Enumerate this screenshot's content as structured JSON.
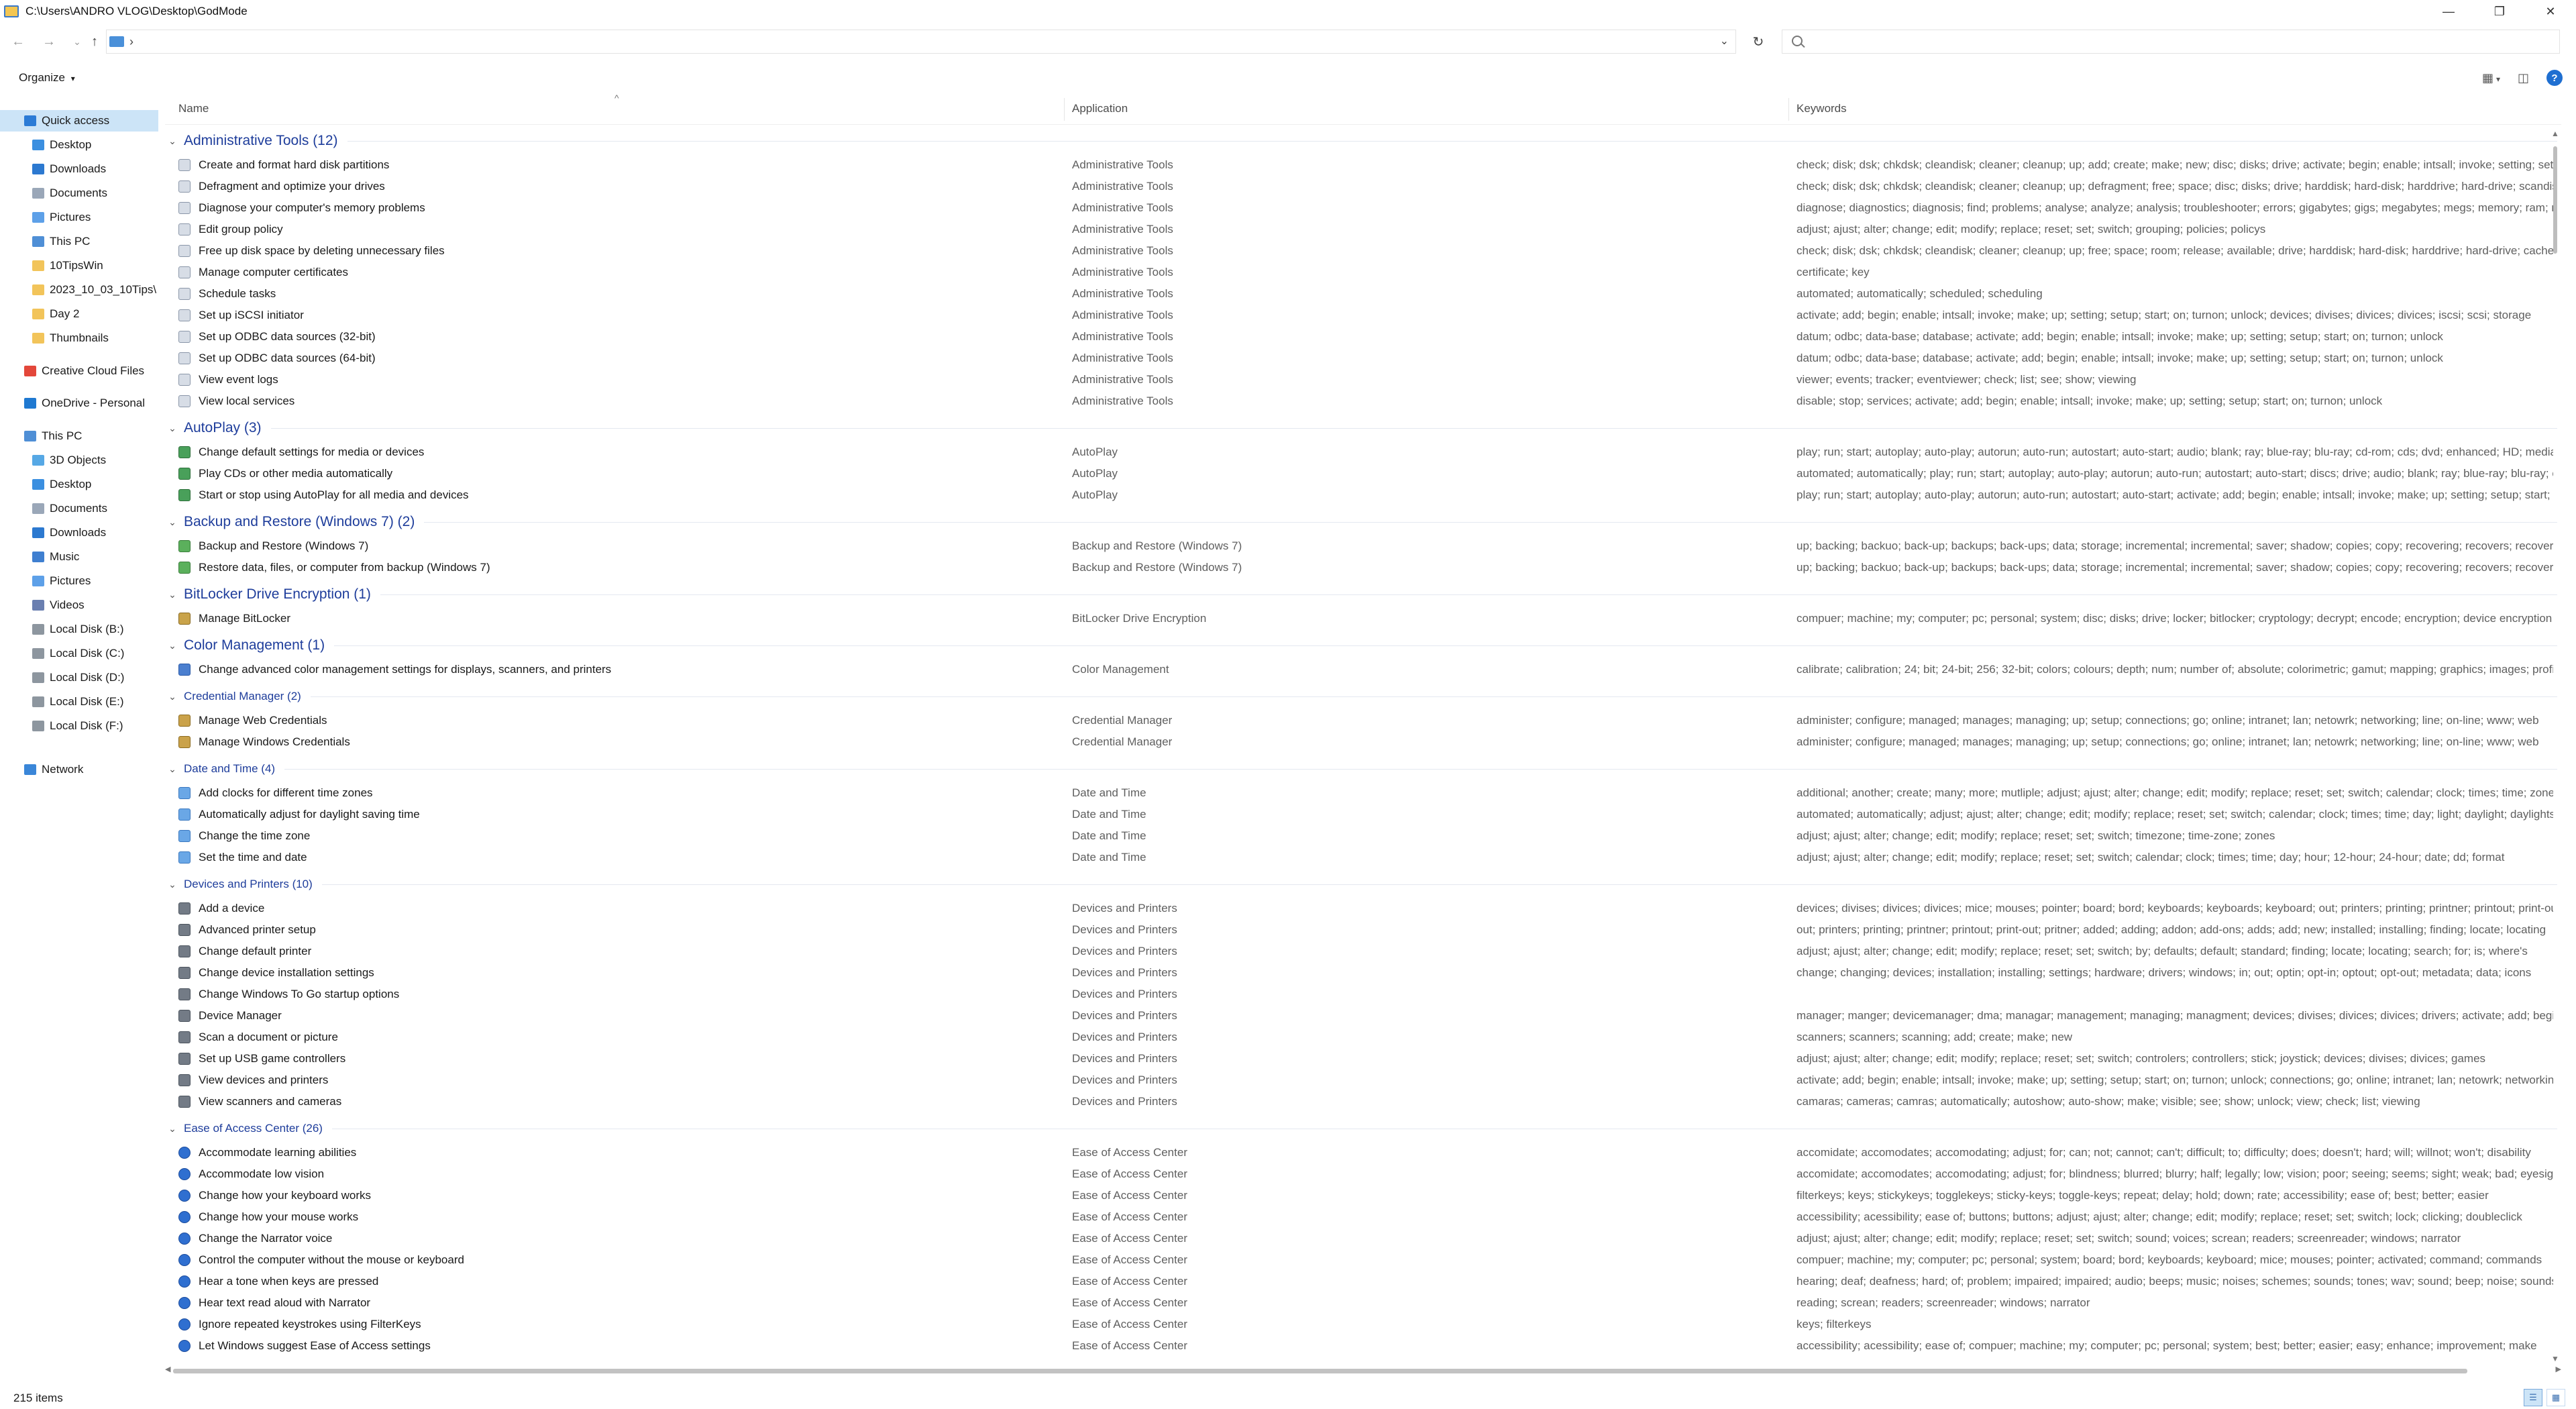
{
  "window": {
    "title": "C:\\Users\\ANDRO VLOG\\Desktop\\GodMode",
    "minimize": "—",
    "maximize": "❐",
    "close": "✕"
  },
  "address": {
    "chevron": "›",
    "dropdown": "⌄",
    "refresh": "↻",
    "search_placeholder": ""
  },
  "nav": {
    "back": "←",
    "forward": "→",
    "recent": "⌄",
    "up": "↑"
  },
  "toolbar": {
    "organize": "Organize",
    "organize_arrow": "▾",
    "view_icon": "▦",
    "view_arrow": "▾",
    "pane_icon": "◫",
    "help": "?"
  },
  "sidebar": {
    "items": [
      {
        "label": "Quick access",
        "indent": 1,
        "icon": "star-icon",
        "color": "#2b7bd6",
        "selected": true,
        "pinned": false
      },
      {
        "label": "Desktop",
        "indent": 2,
        "icon": "desktop-icon",
        "color": "#3b8fe0",
        "selected": false,
        "pinned": true
      },
      {
        "label": "Downloads",
        "indent": 2,
        "icon": "download-icon",
        "color": "#2c79d0",
        "selected": false,
        "pinned": true
      },
      {
        "label": "Documents",
        "indent": 2,
        "icon": "documents-icon",
        "color": "#9aa7b8",
        "selected": false,
        "pinned": true
      },
      {
        "label": "Pictures",
        "indent": 2,
        "icon": "pictures-icon",
        "color": "#5da0e8",
        "selected": false,
        "pinned": true
      },
      {
        "label": "This PC",
        "indent": 2,
        "icon": "computer-icon",
        "color": "#4f8fd6",
        "selected": false,
        "pinned": true
      },
      {
        "label": "10TipsWin",
        "indent": 2,
        "icon": "folder-icon",
        "color": "#f2c45a",
        "selected": false,
        "pinned": false
      },
      {
        "label": "2023_10_03_10Tips\\",
        "indent": 2,
        "icon": "folder-icon",
        "color": "#f2c45a",
        "selected": false,
        "pinned": false
      },
      {
        "label": "Day 2",
        "indent": 2,
        "icon": "folder-icon",
        "color": "#f2c45a",
        "selected": false,
        "pinned": false
      },
      {
        "label": "Thumbnails",
        "indent": 2,
        "icon": "folder-icon",
        "color": "#f2c45a",
        "selected": false,
        "pinned": false
      },
      {
        "label": "Creative Cloud Files",
        "indent": 1,
        "icon": "creative-cloud-icon",
        "color": "#e3473a",
        "selected": false,
        "pinned": false
      },
      {
        "label": "OneDrive - Personal",
        "indent": 1,
        "icon": "cloud-icon",
        "color": "#1f79d1",
        "selected": false,
        "pinned": false
      },
      {
        "label": "This PC",
        "indent": 1,
        "icon": "computer-icon",
        "color": "#4f8fd6",
        "selected": false,
        "pinned": false
      },
      {
        "label": "3D Objects",
        "indent": 2,
        "icon": "cube-icon",
        "color": "#56a8e5",
        "selected": false,
        "pinned": false
      },
      {
        "label": "Desktop",
        "indent": 2,
        "icon": "desktop-icon",
        "color": "#3b8fe0",
        "selected": false,
        "pinned": false
      },
      {
        "label": "Documents",
        "indent": 2,
        "icon": "documents-icon",
        "color": "#9aa7b8",
        "selected": false,
        "pinned": false
      },
      {
        "label": "Downloads",
        "indent": 2,
        "icon": "download-icon",
        "color": "#2c79d0",
        "selected": false,
        "pinned": false
      },
      {
        "label": "Music",
        "indent": 2,
        "icon": "music-icon",
        "color": "#3f7fd0",
        "selected": false,
        "pinned": false
      },
      {
        "label": "Pictures",
        "indent": 2,
        "icon": "pictures-icon",
        "color": "#5da0e8",
        "selected": false,
        "pinned": false
      },
      {
        "label": "Videos",
        "indent": 2,
        "icon": "video-icon",
        "color": "#6a7fb0",
        "selected": false,
        "pinned": false
      },
      {
        "label": "Local Disk (B:)",
        "indent": 2,
        "icon": "drive-icon",
        "color": "#8d969f",
        "selected": false,
        "pinned": false
      },
      {
        "label": "Local Disk (C:)",
        "indent": 2,
        "icon": "drive-icon",
        "color": "#8d969f",
        "selected": false,
        "pinned": false
      },
      {
        "label": "Local Disk (D:)",
        "indent": 2,
        "icon": "drive-icon",
        "color": "#8d969f",
        "selected": false,
        "pinned": false
      },
      {
        "label": "Local Disk (E:)",
        "indent": 2,
        "icon": "drive-icon",
        "color": "#8d969f",
        "selected": false,
        "pinned": false
      },
      {
        "label": "Local Disk (F:)",
        "indent": 2,
        "icon": "drive-icon",
        "color": "#8d969f",
        "selected": false,
        "pinned": false
      },
      {
        "label": "Network",
        "indent": 1,
        "icon": "network-icon",
        "color": "#3a86d8",
        "selected": false,
        "pinned": false
      }
    ],
    "pin_glyph": "📌"
  },
  "columns": {
    "name": "Name",
    "application": "Application",
    "keywords": "Keywords",
    "sort_glyph": "^"
  },
  "groups": [
    {
      "header": "Administrative Tools (12)",
      "large": true,
      "icon": "ic-admin",
      "items": [
        {
          "name": "Create and format hard disk partitions",
          "app": "Administrative Tools",
          "kw": "check; disk; dsk; chkdsk; cleandisk; cleaner; cleanup; up; add; create; make; new; disc; disks; drive; activate; begin; enable; intsall; invoke; setting; setup; start; on; turnon; unlock; dis"
        },
        {
          "name": "Defragment and optimize your drives",
          "app": "Administrative Tools",
          "kw": "check; disk; dsk; chkdsk; cleandisk; cleaner; cleanup; up; defragment; free; space; disc; disks; drive; harddisk; hard-disk; harddrive; hard-drive; scandisk; scan-disk; defrag"
        },
        {
          "name": "Diagnose your computer's memory problems",
          "app": "Administrative Tools",
          "kw": "diagnose; diagnostics; diagnosis; find; problems; analyse; analyze; analysis; troubleshooter; errors; gigabytes; gigs; megabytes; megs; memory; ram; random; access; chips; diag"
        },
        {
          "name": "Edit group policy",
          "app": "Administrative Tools",
          "kw": "adjust; ajust; alter; change; edit; modify; replace; reset; set; switch; grouping; policies; policys"
        },
        {
          "name": "Free up disk space by deleting unnecessary files",
          "app": "Administrative Tools",
          "kw": "check; disk; dsk; chkdsk; cleandisk; cleaner; cleanup; up; free; space; room; release; available; drive; harddisk; hard-disk; harddrive; hard-drive; cache; files; temporary"
        },
        {
          "name": "Manage computer certificates",
          "app": "Administrative Tools",
          "kw": "certificate; key"
        },
        {
          "name": "Schedule tasks",
          "app": "Administrative Tools",
          "kw": "automated; automatically; scheduled; scheduling"
        },
        {
          "name": "Set up iSCSI initiator",
          "app": "Administrative Tools",
          "kw": "activate; add; begin; enable; intsall; invoke; make; up; setting; setup; start; on; turnon; unlock; devices; divises; divices; divices; iscsi; scsi; storage"
        },
        {
          "name": "Set up ODBC data sources (32-bit)",
          "app": "Administrative Tools",
          "kw": "datum; odbc; data-base; database; activate; add; begin; enable; intsall; invoke; make; up; setting; setup; start; on; turnon; unlock"
        },
        {
          "name": "Set up ODBC data sources (64-bit)",
          "app": "Administrative Tools",
          "kw": "datum; odbc; data-base; database; activate; add; begin; enable; intsall; invoke; make; up; setting; setup; start; on; turnon; unlock"
        },
        {
          "name": "View event logs",
          "app": "Administrative Tools",
          "kw": "viewer; events; tracker; eventviewer; check; list; see; show; viewing"
        },
        {
          "name": "View local services",
          "app": "Administrative Tools",
          "kw": "disable; stop; services; activate; add; begin; enable; intsall; invoke; make; up; setting; setup; start; on; turnon; unlock"
        }
      ]
    },
    {
      "header": "AutoPlay (3)",
      "large": true,
      "icon": "ic-auto",
      "items": [
        {
          "name": "Change default settings for media or devices",
          "app": "AutoPlay",
          "kw": "play; run; start; autoplay; auto-play; autorun; auto-run; autostart; auto-start; audio; blank; ray; blue-ray; blu-ray; cd-rom; cds; dvd; enhanced; HD; media; movies; music"
        },
        {
          "name": "Play CDs or other media automatically",
          "app": "AutoPlay",
          "kw": "automated; automatically; play; run; start; autoplay; auto-play; autorun; auto-run; autostart; auto-start; discs; drive; audio; blank; ray; blue-ray; blu-ray; cd"
        },
        {
          "name": "Start or stop using AutoPlay for all media and devices",
          "app": "AutoPlay",
          "kw": "play; run; start; autoplay; auto-play; autorun; auto-run; autostart; auto-start; activate; add; begin; enable; intsall; invoke; make; up; setting; setup; start; on"
        }
      ]
    },
    {
      "header": "Backup and Restore (Windows 7) (2)",
      "large": true,
      "icon": "ic-backup",
      "items": [
        {
          "name": "Backup and Restore (Windows 7)",
          "app": "Backup and Restore (Windows 7)",
          "kw": "up; backing; backuo; back-up; backups; back-ups; data; storage; incremental; incremental; saver; shadow; copies; copy; recovering; recovers; recovery; restore"
        },
        {
          "name": "Restore data, files, or computer from backup (Windows 7)",
          "app": "Backup and Restore (Windows 7)",
          "kw": "up; backing; backuo; back-up; backups; back-ups; data; storage; incremental; incremental; saver; shadow; copies; copy; recovering; recovers; recovery; restore"
        }
      ]
    },
    {
      "header": "BitLocker Drive Encryption (1)",
      "large": true,
      "icon": "ic-bitlocker",
      "items": [
        {
          "name": "Manage BitLocker",
          "app": "BitLocker Drive Encryption",
          "kw": "compuer; machine; my; computer; pc; personal; system; disc; disks; drive; locker; bitlocker; cryptology; decrypt; encode; encryption; device encryption"
        }
      ]
    },
    {
      "header": "Color Management (1)",
      "large": true,
      "icon": "ic-color",
      "items": [
        {
          "name": "Change advanced color management settings for displays, scanners, and printers",
          "app": "Color Management",
          "kw": "calibrate; calibration; 24; bit; 24-bit; 256; 32-bit; colors; colours; depth; num; number of; absolute; colorimetric; gamut; mapping; graphics; images; profile"
        }
      ]
    },
    {
      "header": "Credential Manager (2)",
      "large": false,
      "icon": "ic-cred",
      "items": [
        {
          "name": "Manage Web Credentials",
          "app": "Credential Manager",
          "kw": "administer; configure; managed; manages; managing; up; setup; connections; go; online; intranet; lan; netowrk; networking; line; on-line; www; web"
        },
        {
          "name": "Manage Windows Credentials",
          "app": "Credential Manager",
          "kw": "administer; configure; managed; manages; managing; up; setup; connections; go; online; intranet; lan; netowrk; networking; line; on-line; www; web"
        }
      ]
    },
    {
      "header": "Date and Time (4)",
      "large": false,
      "icon": "ic-date",
      "items": [
        {
          "name": "Add clocks for different time zones",
          "app": "Date and Time",
          "kw": "additional; another; create; many; more; mutliple; adjust; ajust; alter; change; edit; modify; replace; reset; set; switch; calendar; clock; times; time; zones"
        },
        {
          "name": "Automatically adjust for daylight saving time",
          "app": "Date and Time",
          "kw": "automated; automatically; adjust; ajust; alter; change; edit; modify; replace; reset; set; switch; calendar; clock; times; time; day; light; daylight; daylightsavings"
        },
        {
          "name": "Change the time zone",
          "app": "Date and Time",
          "kw": "adjust; ajust; alter; change; edit; modify; replace; reset; set; switch; timezone; time-zone; zones"
        },
        {
          "name": "Set the time and date",
          "app": "Date and Time",
          "kw": "adjust; ajust; alter; change; edit; modify; replace; reset; set; switch; calendar; clock; times; time; day; hour; 12-hour; 24-hour; date; dd; format"
        }
      ]
    },
    {
      "header": "Devices and Printers (10)",
      "large": false,
      "icon": "ic-dev",
      "items": [
        {
          "name": "Add a device",
          "app": "Devices and Printers",
          "kw": "devices; divises; divices; divices; mice; mouses; pointer; board; bord; keyboards; keyboards; keyboard; out; printers; printing; printner; printout; print-out"
        },
        {
          "name": "Advanced printer setup",
          "app": "Devices and Printers",
          "kw": "out; printers; printing; printner; printout; print-out; pritner; added; adding; addon; add-ons; adds; add; new; installed; installing; finding; locate; locating"
        },
        {
          "name": "Change default printer",
          "app": "Devices and Printers",
          "kw": "adjust; ajust; alter; change; edit; modify; replace; reset; set; switch; by; defaults; default; standard; finding; locate; locating; search; for; is; where's"
        },
        {
          "name": "Change device installation settings",
          "app": "Devices and Printers",
          "kw": "change; changing; devices; installation; installing; settings; hardware; drivers; windows; in; out; optin; opt-in; optout; opt-out; metadata; data; icons"
        },
        {
          "name": "Change Windows To Go startup options",
          "app": "Devices and Printers",
          "kw": ""
        },
        {
          "name": "Device Manager",
          "app": "Devices and Printers",
          "kw": "manager; manger; devicemanager; dma; managar; management; managing; managment; devices; divises; divices; divices; drivers; activate; add; begin"
        },
        {
          "name": "Scan a document or picture",
          "app": "Devices and Printers",
          "kw": "scanners; scanners; scanning; add; create; make; new"
        },
        {
          "name": "Set up USB game controllers",
          "app": "Devices and Printers",
          "kw": "adjust; ajust; alter; change; edit; modify; replace; reset; set; switch; controlers; controllers; stick; joystick; devices; divises; divices; games"
        },
        {
          "name": "View devices and printers",
          "app": "Devices and Printers",
          "kw": "activate; add; begin; enable; intsall; invoke; make; up; setting; setup; start; on; turnon; unlock; connections; go; online; intranet; lan; netowrk; networking"
        },
        {
          "name": "View scanners and cameras",
          "app": "Devices and Printers",
          "kw": "camaras; cameras; camras; automatically; autoshow; auto-show; make; visible; see; show; unlock; view; check; list; viewing"
        }
      ]
    },
    {
      "header": "Ease of Access Center (26)",
      "large": false,
      "icon": "ic-ease",
      "items": [
        {
          "name": "Accommodate learning abilities",
          "app": "Ease of Access Center",
          "kw": "accomidate; accomodates; accomodating; adjust; for; can; not; cannot; can't; difficult; to; difficulty; does; doesn't; hard; will; willnot; won't; disability"
        },
        {
          "name": "Accommodate low vision",
          "app": "Ease of Access Center",
          "kw": "accomidate; accomodates; accomodating; adjust; for; blindness; blurred; blurry; half; legally; low; vision; poor; seeing; seems; sight; weak; bad; eyesight"
        },
        {
          "name": "Change how your keyboard works",
          "app": "Ease of Access Center",
          "kw": "filterkeys; keys; stickykeys; togglekeys; sticky-keys; toggle-keys; repeat; delay; hold; down; rate; accessibility; ease of; best; better; easier"
        },
        {
          "name": "Change how your mouse works",
          "app": "Ease of Access Center",
          "kw": "accessibility; acessibility; ease of; buttons; buttons; adjust; ajust; alter; change; edit; modify; replace; reset; set; switch; lock; clicking; doubleclick"
        },
        {
          "name": "Change the Narrator voice",
          "app": "Ease of Access Center",
          "kw": "adjust; ajust; alter; change; edit; modify; replace; reset; set; switch; sound; voices; screan; readers; screenreader; windows; narrator"
        },
        {
          "name": "Control the computer without the mouse or keyboard",
          "app": "Ease of Access Center",
          "kw": "compuer; machine; my; computer; pc; personal; system; board; bord; keyboards; keyboard; mice; mouses; pointer; activated; command; commands"
        },
        {
          "name": "Hear a tone when keys are pressed",
          "app": "Ease of Access Center",
          "kw": "hearing; deaf; deafness; hard; of; problem; impaired; impaired; audio; beeps; music; noises; schemes; sounds; tones; wav; sound; beep; noise; sounds"
        },
        {
          "name": "Hear text read aloud with Narrator",
          "app": "Ease of Access Center",
          "kw": "reading; screan; readers; screenreader; windows; narrator"
        },
        {
          "name": "Ignore repeated keystrokes using FilterKeys",
          "app": "Ease of Access Center",
          "kw": "keys; filterkeys"
        },
        {
          "name": "Let Windows suggest Ease of Access settings",
          "app": "Ease of Access Center",
          "kw": "accessibility; acessibility; ease of; compuer; machine; my; computer; pc; personal; system; best; better; easier; easy; enhance; improvement; make"
        }
      ]
    }
  ],
  "status": {
    "items_count": "215 items",
    "details_view": "☰",
    "tiles_view": "▦"
  },
  "scroll": {
    "up": "▲",
    "down": "▼",
    "left": "◀",
    "right": "▶"
  }
}
